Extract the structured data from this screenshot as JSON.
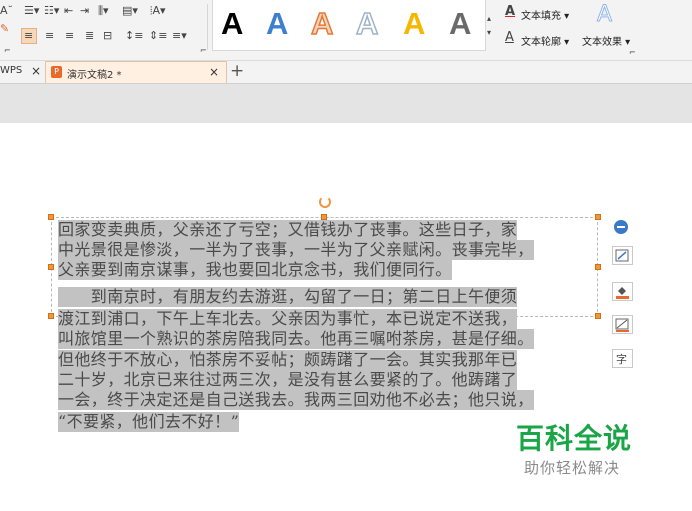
{
  "ribbon": {
    "text_fill_label": "文本填充",
    "text_outline_label": "文本轮廓",
    "text_effects_label": "文本效果",
    "wordart_glyph": "A",
    "wordart_styles": [
      {
        "name": "black-bold",
        "color": "#000000"
      },
      {
        "name": "blue",
        "color": "#3f7fcf"
      },
      {
        "name": "orange-outline",
        "color": "#f0a070"
      },
      {
        "name": "light-outline",
        "color": "#ffffff"
      },
      {
        "name": "gold",
        "color": "#f5b800"
      },
      {
        "name": "gray",
        "color": "#6a6a6a"
      }
    ],
    "accent_red": "#d9232e",
    "text_effects_glyph_color": "#8fb4e6"
  },
  "tabs": {
    "prev_tab": "WPS",
    "active_tab": "演示文稿2 *",
    "close_glyph": "×",
    "add_glyph": "+"
  },
  "textbox": {
    "lines": [
      "回家变卖典质，父亲还了亏空；又借钱办了丧事。这些日子，家",
      "中光景很是惨淡，一半为了丧事，一半为了父亲赋闲。丧事完毕，",
      "父亲要到南京谋事，我也要回北京念书，我们便同行。",
      "　　到南京时，有朋友约去游逛，勾留了一日；第二日上午便须",
      "渡江到浦口，下午上车北去。父亲因为事忙，本已说定不送我，",
      "叫旅馆里一个熟识的茶房陪我同去。他再三嘱咐茶房，甚是仔细。",
      "但他终于不放心，怕茶房不妥帖；颇踌躇了一会。其实我那年已",
      "二十岁，北京已来往过两三次，是没有甚么要紧的了。他踌躇了",
      "一会，终于决定还是自己送我去。我两三回劝他不必去；他只说，",
      "“不要紧，他们去不好！”"
    ],
    "selection_color": "#c2c2c2"
  },
  "watermark": {
    "brand": "百科全说",
    "slogan": "助你轻松解决",
    "brand_color": "#1aa646"
  }
}
